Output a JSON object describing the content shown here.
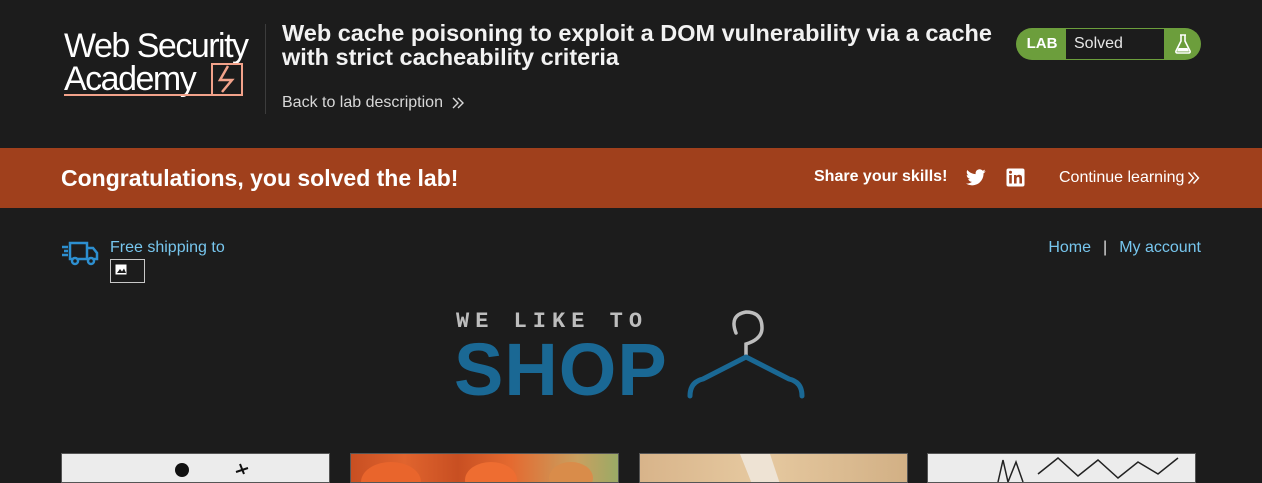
{
  "header": {
    "logo_text": "Web Security Academy",
    "lab_title": "Web cache poisoning to exploit a DOM vulnerability via a cache with strict cacheability criteria",
    "back_link": "Back to lab description",
    "status_badge_label": "LAB",
    "status": "Solved"
  },
  "banner": {
    "message": "Congratulations, you solved the lab!",
    "share_label": "Share your skills!",
    "continue_label": "Continue learning"
  },
  "shop_header": {
    "shipping_label": "Free shipping to",
    "nav": {
      "home": "Home",
      "separator": "|",
      "account": "My account"
    }
  },
  "shop_logo": {
    "tagline": "WE LIKE TO",
    "word": "SHOP"
  },
  "products": [
    {
      "image": "product-image-1"
    },
    {
      "image": "product-image-2"
    },
    {
      "image": "product-image-3"
    },
    {
      "image": "product-image-4"
    }
  ],
  "colors": {
    "background": "#1c1c1c",
    "banner": "#a0401c",
    "solved_green": "#6c9e3c",
    "link_blue": "#77c6ee",
    "shop_blue": "#1a6894",
    "logo_accent": "#f2a28a"
  }
}
